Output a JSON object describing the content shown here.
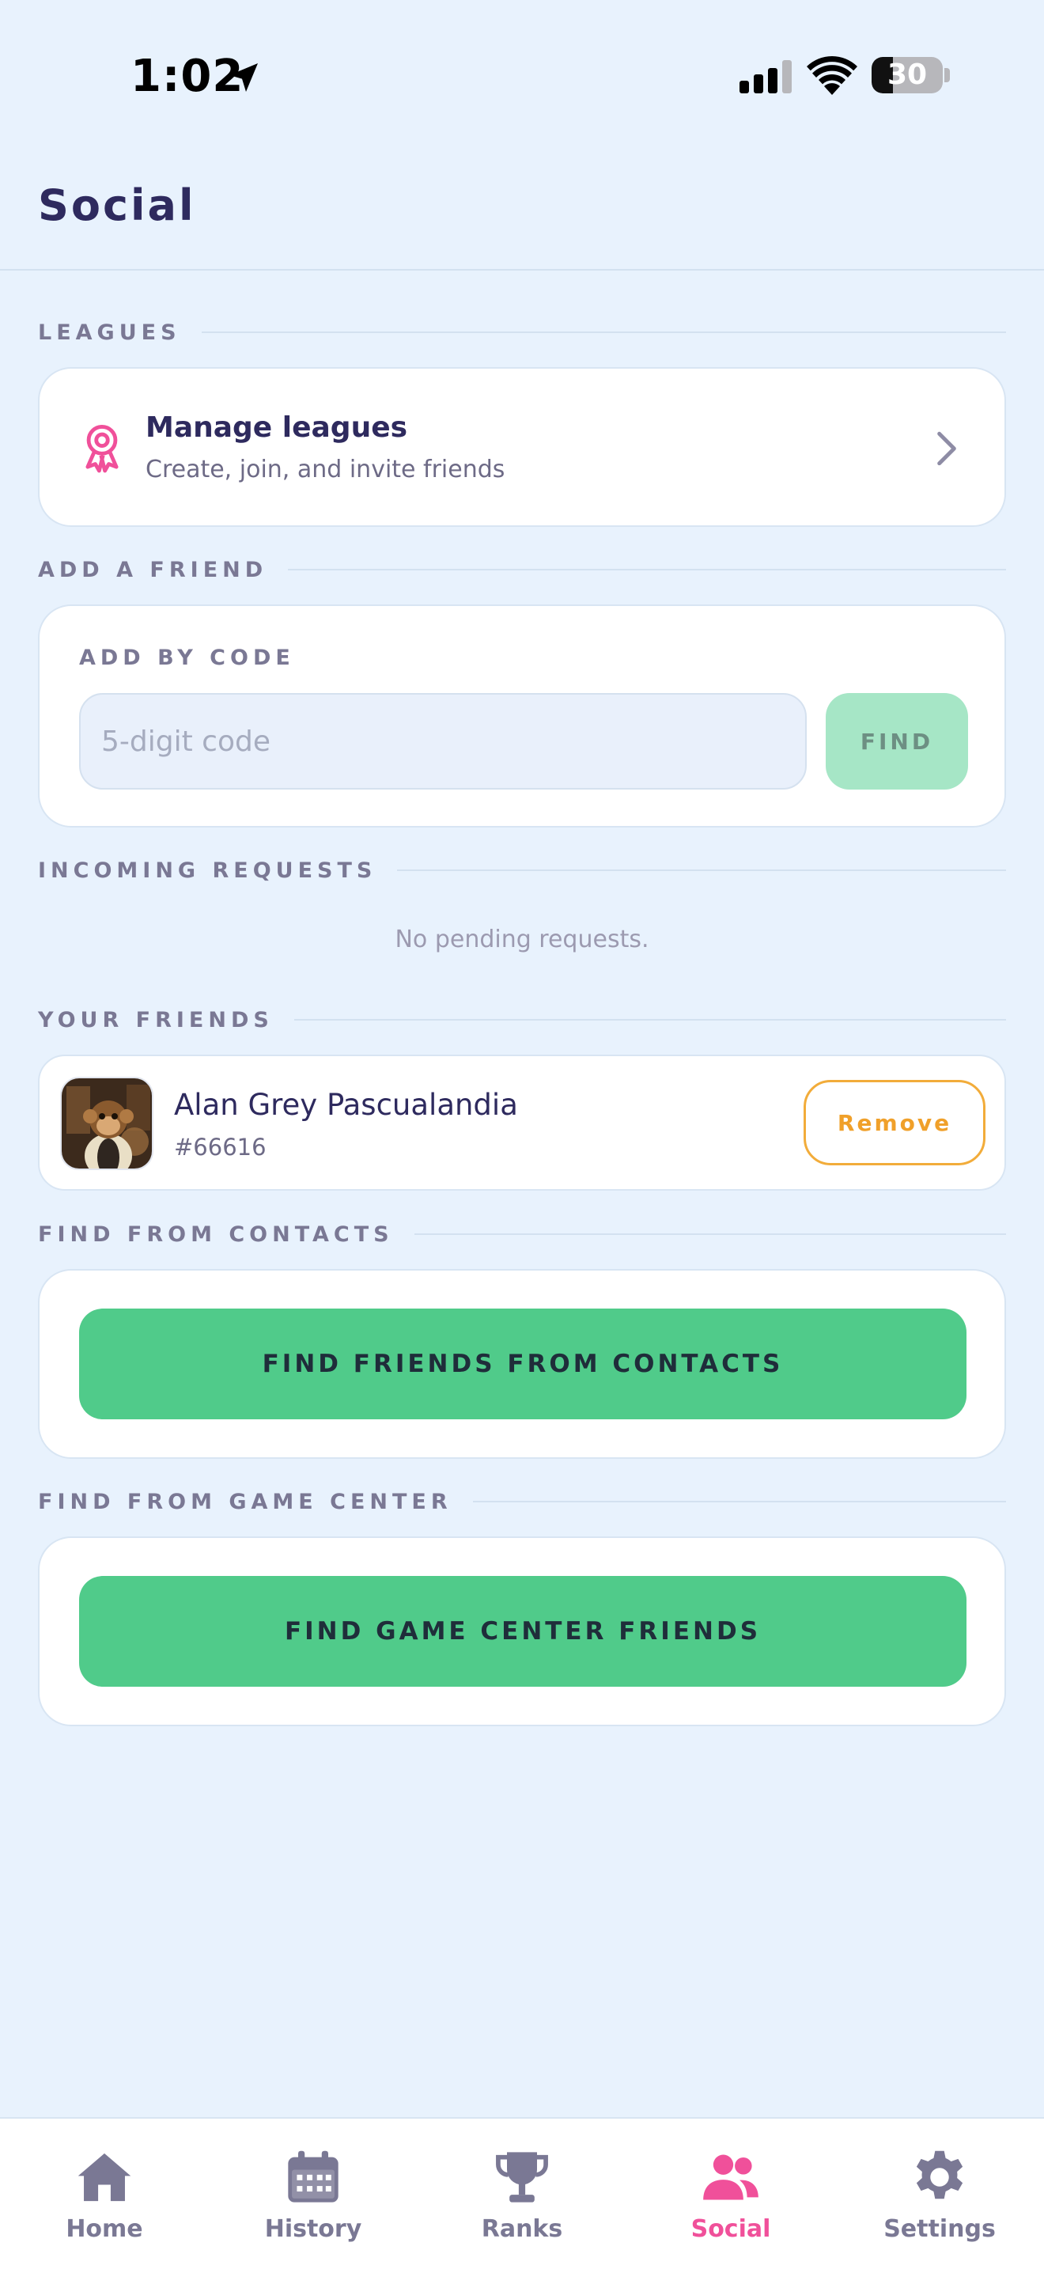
{
  "status_bar": {
    "time": "1:02",
    "battery": "30",
    "battery_level": 0.3
  },
  "header": {
    "title": "Social"
  },
  "sections": {
    "leagues": "LEAGUES",
    "add_friend": "ADD A FRIEND",
    "incoming": "INCOMING REQUESTS",
    "friends": "YOUR FRIENDS",
    "contacts": "FIND FROM CONTACTS",
    "game_center": "FIND FROM GAME CENTER"
  },
  "leagues_card": {
    "title": "Manage leagues",
    "subtitle": "Create, join, and invite friends"
  },
  "add_by_code": {
    "label": "ADD BY CODE",
    "placeholder": "5-digit code",
    "value": "",
    "find_label": "FIND"
  },
  "incoming_requests": {
    "empty_text": "No pending requests."
  },
  "friends": [
    {
      "name": "Alan Grey Pascualandia",
      "code": "#66616",
      "remove_label": "Remove"
    }
  ],
  "contacts_button": "FIND FRIENDS FROM CONTACTS",
  "game_center_button": "FIND GAME CENTER FRIENDS",
  "tab_bar": [
    {
      "label": "Home",
      "icon": "home-icon",
      "active": false
    },
    {
      "label": "History",
      "icon": "calendar-icon",
      "active": false
    },
    {
      "label": "Ranks",
      "icon": "trophy-icon",
      "active": false
    },
    {
      "label": "Social",
      "icon": "people-icon",
      "active": true
    },
    {
      "label": "Settings",
      "icon": "gear-icon",
      "active": false
    }
  ],
  "colors": {
    "background": "#e8f2fd",
    "accent_pink": "#f0509a",
    "primary_green": "#50cb8a",
    "remove_orange": "#f2ac3a",
    "text_dark": "#2e2a5e"
  }
}
